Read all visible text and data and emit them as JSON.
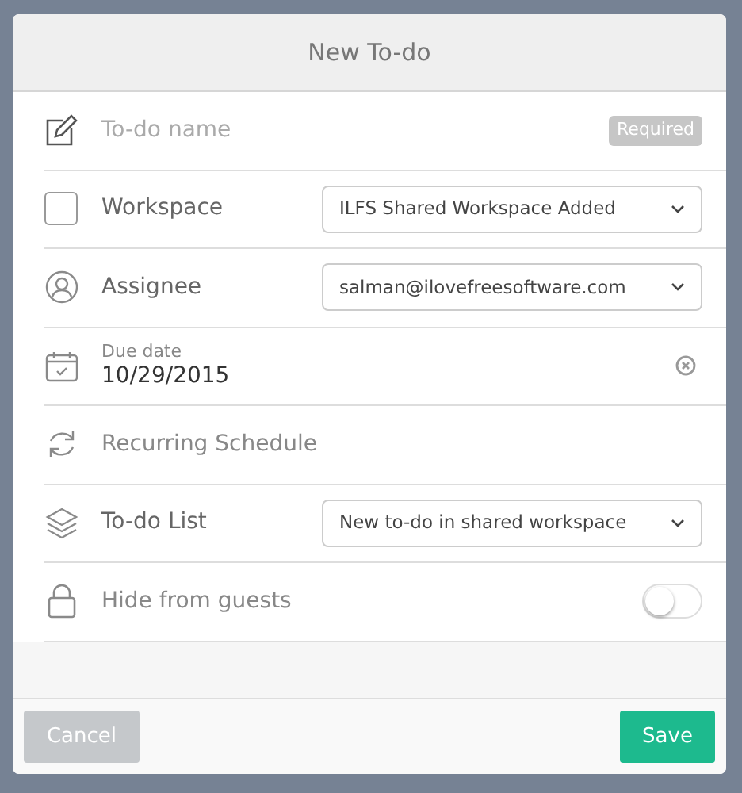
{
  "dialog": {
    "title": "New To-do"
  },
  "rows": [
    {
      "kind": "name",
      "label": "To-do name",
      "badge": "Required"
    },
    {
      "kind": "select",
      "label": "Workspace",
      "checked": false,
      "value": "ILFS Shared Workspace Added"
    },
    {
      "kind": "select",
      "label": "Assignee",
      "value": "salman@ilovefreesoftware.com"
    },
    {
      "kind": "date",
      "label": "Due date",
      "value": "10/29/2015"
    },
    {
      "kind": "plain",
      "label": "Recurring Schedule"
    },
    {
      "kind": "select",
      "label": "To-do List",
      "value": "New to-do in shared workspace"
    },
    {
      "kind": "toggle",
      "label": "Hide from guests",
      "on": false
    }
  ],
  "buttons": {
    "cancel": {
      "label": "Cancel",
      "disabled": true
    },
    "save": {
      "label": "Save"
    }
  }
}
